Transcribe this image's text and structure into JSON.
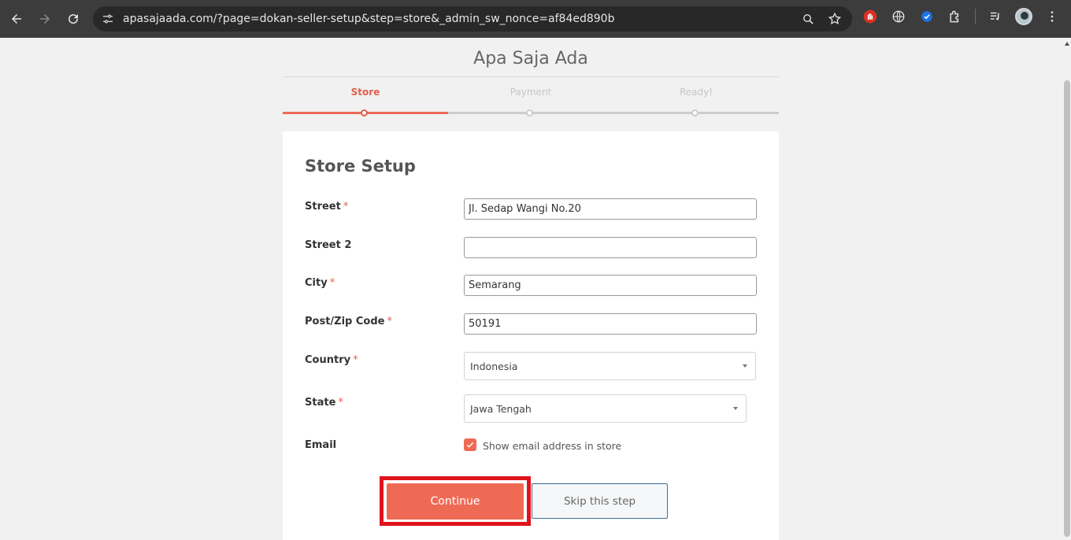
{
  "browser": {
    "url": "apasajaada.com/?page=dokan-seller-setup&step=store&_admin_sw_nonce=af84ed890b",
    "icons": [
      "back-icon",
      "forward-icon",
      "reload-icon",
      "site-settings-icon",
      "zoom-icon",
      "bookmark-star-icon",
      "extension-hand-icon",
      "extension-globe-icon",
      "extension-check-icon",
      "extensions-puzzle-icon",
      "media-control-icon",
      "profile-avatar",
      "menu-dots-icon"
    ]
  },
  "page": {
    "site_title": "Apa Saja Ada",
    "steps": [
      {
        "label": "Store",
        "active": true
      },
      {
        "label": "Payment",
        "active": false
      },
      {
        "label": "Ready!",
        "active": false
      }
    ],
    "form_title": "Store Setup",
    "fields": {
      "street": {
        "label": "Street",
        "required": "*",
        "value": "Jl. Sedap Wangi No.20"
      },
      "street2": {
        "label": "Street 2",
        "value": ""
      },
      "city": {
        "label": "City",
        "required": "*",
        "value": "Semarang"
      },
      "zip": {
        "label": "Post/Zip Code",
        "required": "*",
        "value": "50191"
      },
      "country": {
        "label": "Country",
        "required": "*",
        "value": "Indonesia"
      },
      "state": {
        "label": "State",
        "required": "*",
        "value": "Jawa Tengah"
      },
      "email": {
        "label": "Email",
        "checkbox_label": "Show email address in store",
        "checked": true
      }
    },
    "buttons": {
      "continue": "Continue",
      "skip": "Skip this step"
    }
  },
  "colors": {
    "accent": "#ef6a55",
    "highlight": "#e0131d",
    "chrome": "#3c3c3c"
  }
}
